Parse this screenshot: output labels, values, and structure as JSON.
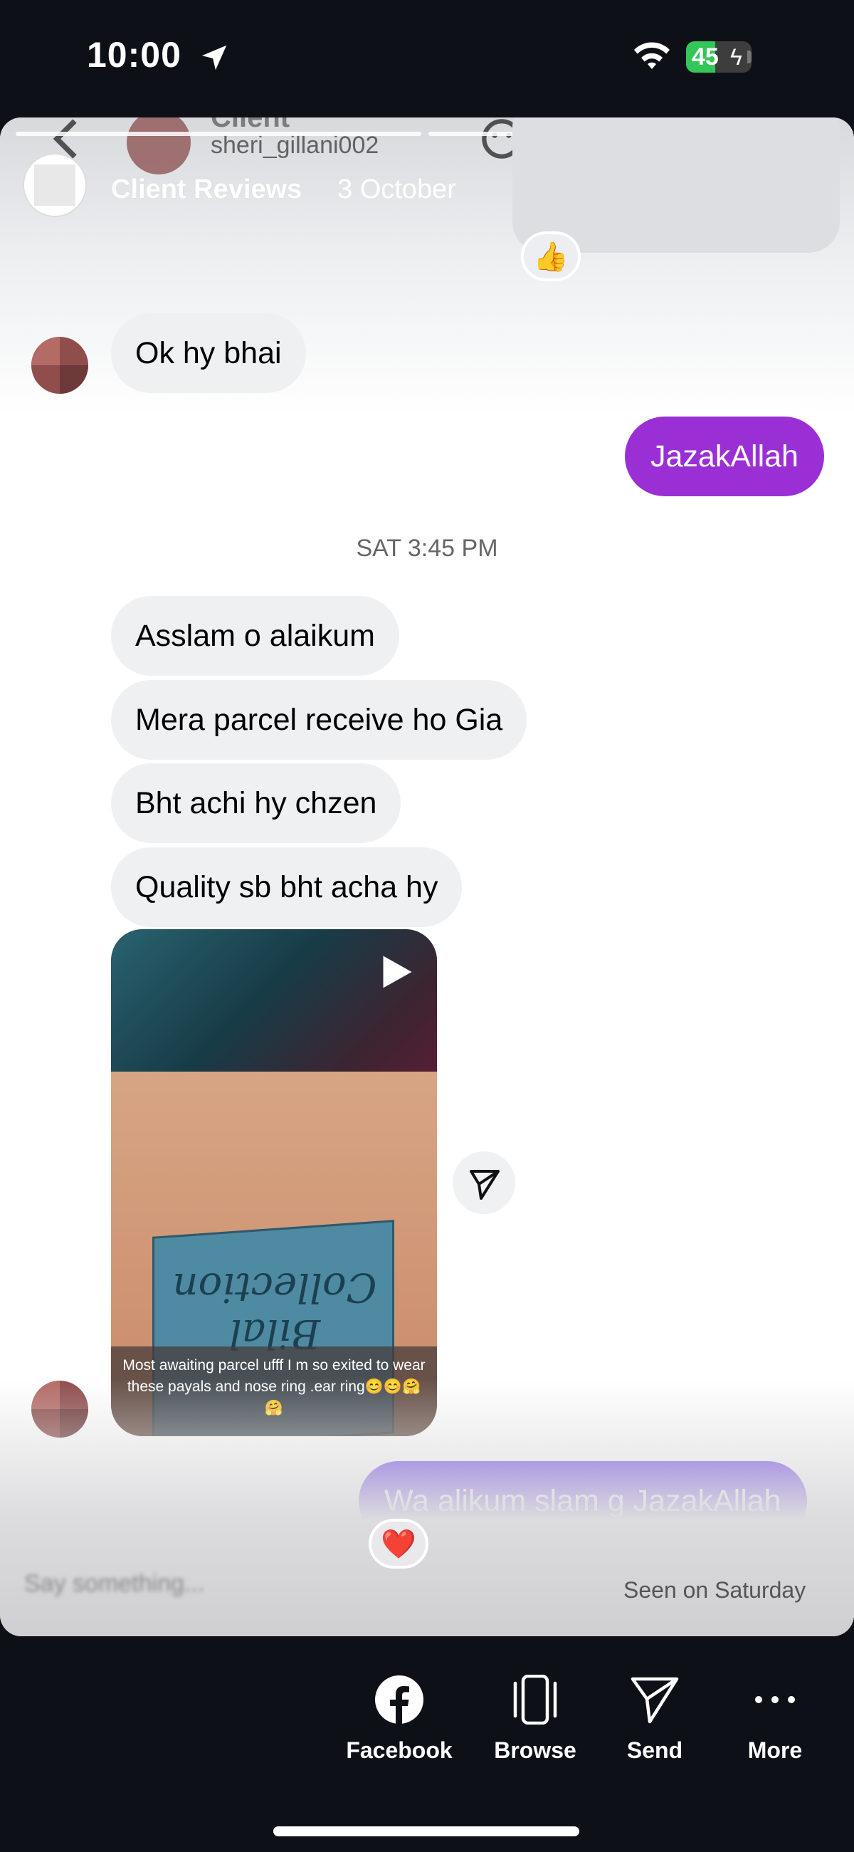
{
  "status_bar": {
    "time": "10:00",
    "battery": "45",
    "battery_level_percent": 45
  },
  "background_header": {
    "name": "Client",
    "username": "sheri_gillani002"
  },
  "story": {
    "title": "Client Reviews",
    "date": "3 October",
    "segments": 6,
    "active_segment": 4
  },
  "chat": {
    "reaction_top": "👍",
    "msg_ok": "Ok hy bhai",
    "msg_jazak": "JazakAllah",
    "timestamp": "SAT 3:45 PM",
    "incoming": [
      "Asslam o alaikum",
      "Mera parcel receive ho Gia",
      "Bht achi hy chzen",
      "Quality sb bht acha hy"
    ],
    "video": {
      "box_text": "Bilal Collection",
      "caption": "Most awaiting parcel ufff I m so exited to wear these payals and nose ring .ear ring😊😊🤗 🤗"
    },
    "reply": "Wa alikum slam g JazakAllah",
    "reply_reaction": "❤️",
    "seen": "Seen on Saturday",
    "input_placeholder": "Say something..."
  },
  "actions": [
    {
      "label": "Facebook",
      "icon": "facebook-icon"
    },
    {
      "label": "Browse",
      "icon": "browse-icon"
    },
    {
      "label": "Send",
      "icon": "send-icon"
    },
    {
      "label": "More",
      "icon": "more-icon"
    }
  ],
  "colors": {
    "outgoing_purple": "#9b2fd6",
    "outgoing_violet": "#6d3ee8",
    "incoming_gray": "#eff0f2",
    "background": "#0d1117"
  }
}
